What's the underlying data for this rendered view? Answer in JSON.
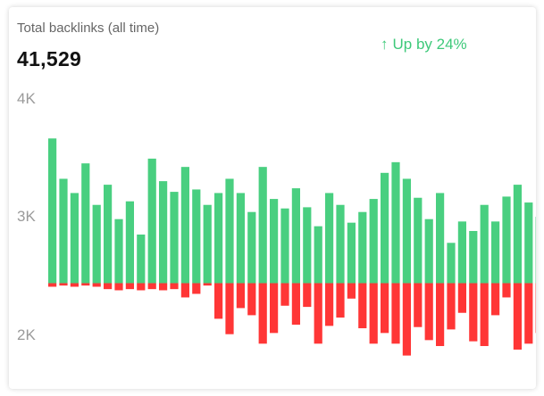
{
  "card": {
    "label": "Total backlinks (all time)",
    "total": "41,529",
    "trend": {
      "arrow": "↑",
      "text": "Up by 24%"
    }
  },
  "colors": {
    "gained": "#49cf80",
    "lost": "#ff3636"
  },
  "chart_data": {
    "type": "bar",
    "yticks": [
      "4K",
      "3K",
      "2K"
    ],
    "ylim": [
      1800,
      4400
    ],
    "baseline": 2500,
    "grid": false,
    "legend": "none",
    "gained": [
      3720,
      3380,
      3260,
      3510,
      3160,
      3330,
      3040,
      3190,
      2910,
      3550,
      3360,
      3270,
      3480,
      3290,
      3160,
      3260,
      3380,
      3260,
      3100,
      3480,
      3210,
      3130,
      3300,
      3140,
      2980,
      3260,
      3160,
      3010,
      3100,
      3210,
      3430,
      3520,
      3380,
      3220,
      3040,
      3260,
      2840,
      3020,
      2940,
      3160,
      3020,
      3230,
      3330,
      3180,
      3060
    ],
    "lost": [
      2470,
      2480,
      2470,
      2480,
      2470,
      2450,
      2440,
      2450,
      2440,
      2450,
      2440,
      2450,
      2380,
      2410,
      2480,
      2200,
      2070,
      2290,
      2230,
      1990,
      2080,
      2310,
      2150,
      2300,
      1990,
      2140,
      2210,
      2370,
      2120,
      1990,
      2080,
      1990,
      1890,
      2130,
      2020,
      1970,
      2110,
      2250,
      2010,
      1970,
      2230,
      2380,
      1940,
      1990,
      2080
    ]
  }
}
